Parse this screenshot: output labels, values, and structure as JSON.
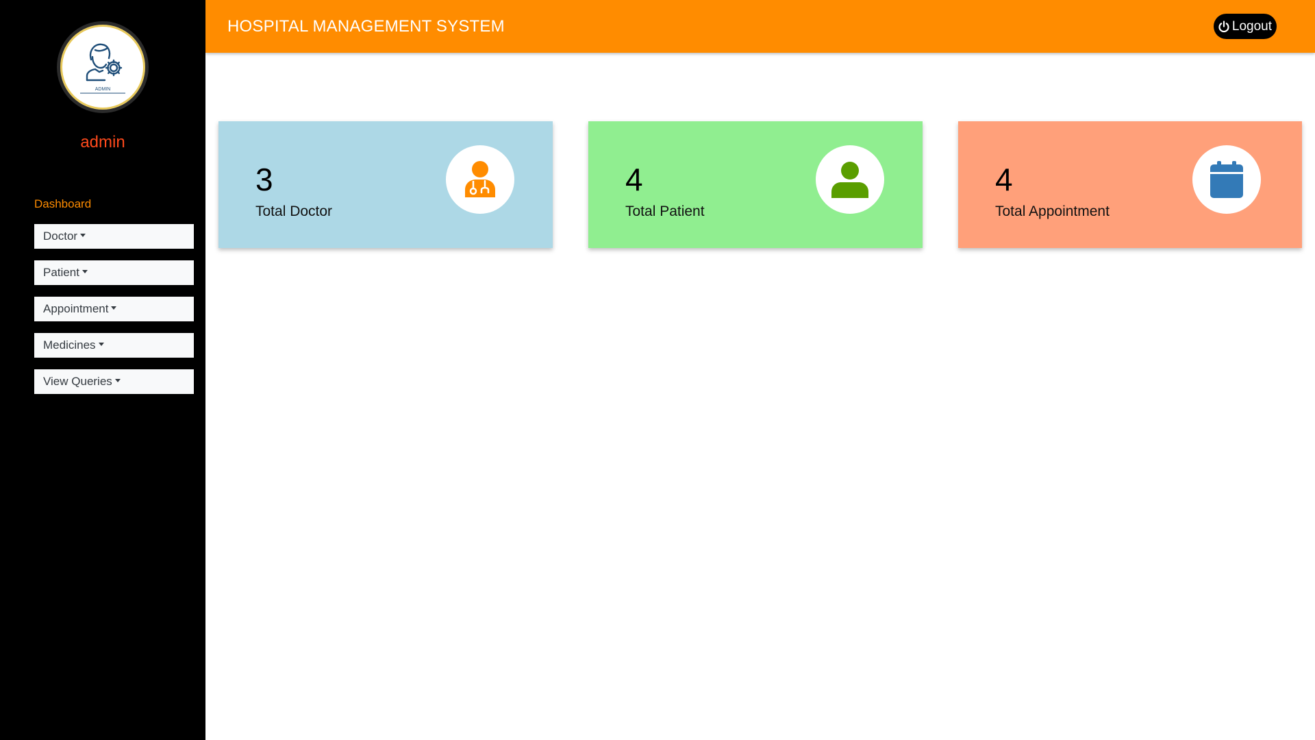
{
  "sidebar": {
    "avatar_caption": "ADMIN",
    "username": "admin",
    "dashboard_label": "Dashboard",
    "menu": [
      {
        "label": "Doctor"
      },
      {
        "label": "Patient"
      },
      {
        "label": "Appointment"
      },
      {
        "label": "Medicines"
      },
      {
        "label": "View Queries"
      }
    ]
  },
  "header": {
    "title": "HOSPITAL MANAGEMENT SYSTEM",
    "logout_label": "Logout",
    "power_icon": "power-icon"
  },
  "cards": [
    {
      "value": "3",
      "label": "Total Doctor",
      "bg": "#add8e6",
      "icon": "doctor-icon",
      "icon_color": "#ff8c00"
    },
    {
      "value": "4",
      "label": "Total Patient",
      "bg": "#90ee90",
      "icon": "patient-icon",
      "icon_color": "#5a9e00"
    },
    {
      "value": "4",
      "label": "Total Appointment",
      "bg": "#ffa07a",
      "icon": "calendar-icon",
      "icon_color": "#337ab7"
    }
  ],
  "colors": {
    "header_bg": "#ff8c00",
    "sidebar_bg": "#000000",
    "username": "#ff4a1c",
    "dashboard_link": "#ff8c00"
  }
}
